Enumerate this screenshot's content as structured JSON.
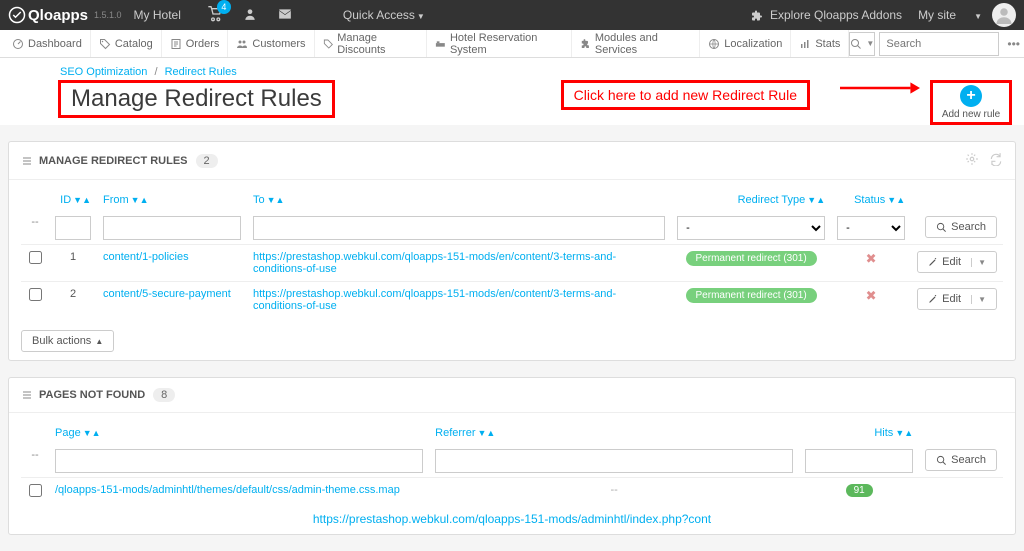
{
  "topbar": {
    "brand": "Qloapps",
    "version": "1.5.1.0",
    "my_hotel": "My Hotel",
    "cart_badge": "4",
    "quick_access": "Quick Access",
    "addons": "Explore Qloapps Addons",
    "my_site": "My site"
  },
  "nav": {
    "dashboard": "Dashboard",
    "catalog": "Catalog",
    "orders": "Orders",
    "customers": "Customers",
    "discounts": "Manage Discounts",
    "hrs": "Hotel Reservation System",
    "modules": "Modules and Services",
    "localization": "Localization",
    "stats": "Stats",
    "search_placeholder": "Search"
  },
  "breadcrumb": {
    "a": "SEO Optimization",
    "b": "Redirect Rules"
  },
  "page_title": "Manage Redirect Rules",
  "callout": "Click here to add new Redirect Rule",
  "add_label": "Add new rule",
  "panel1": {
    "title": "MANAGE REDIRECT RULES",
    "count": "2",
    "cols": {
      "id": "ID",
      "from": "From",
      "to": "To",
      "type": "Redirect Type",
      "status": "Status"
    },
    "filter_type_default": "-",
    "filter_status_default": "-",
    "search_btn": "Search",
    "rows": [
      {
        "id": "1",
        "from": "content/1-policies",
        "to": "https://prestashop.webkul.com/qloapps-151-mods/en/content/3-terms-and-conditions-of-use",
        "type": "Permanent redirect (301)",
        "edit": "Edit"
      },
      {
        "id": "2",
        "from": "content/5-secure-payment",
        "to": "https://prestashop.webkul.com/qloapps-151-mods/en/content/3-terms-and-conditions-of-use",
        "type": "Permanent redirect (301)",
        "edit": "Edit"
      }
    ],
    "bulk": "Bulk actions"
  },
  "panel2": {
    "title": "PAGES NOT FOUND",
    "count": "8",
    "cols": {
      "page": "Page",
      "referrer": "Referrer",
      "hits": "Hits"
    },
    "search_btn": "Search",
    "rows": [
      {
        "page": "/qloapps-151-mods/adminhtl/themes/default/css/admin-theme.css.map",
        "referrer": "--",
        "hits": "91"
      }
    ],
    "cut_url": "https://prestashop.webkul.com/qloapps-151-mods/adminhtl/index.php?cont"
  }
}
